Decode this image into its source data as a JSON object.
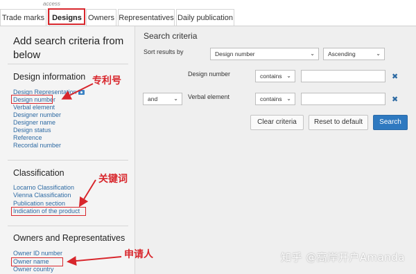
{
  "top_note": "access",
  "tabs": [
    {
      "label": "Trade marks"
    },
    {
      "label": "Designs"
    },
    {
      "label": "Owners"
    },
    {
      "label": "Representatives"
    },
    {
      "label": "Daily publication"
    }
  ],
  "left": {
    "title": "Add search criteria from below",
    "sections": [
      {
        "heading": "Design information",
        "items": [
          "Design Representation",
          "Design number",
          "Verbal element",
          "Designer number",
          "Designer name",
          "Design status",
          "Reference",
          "Recordal number"
        ]
      },
      {
        "heading": "Classification",
        "items": [
          "Locarno Classification",
          "Vienna Classification",
          "Publication section",
          "Indication of the product"
        ]
      },
      {
        "heading": "Owners and Representatives",
        "items": [
          "Owner ID number",
          "Owner name",
          "Owner country"
        ]
      }
    ]
  },
  "right": {
    "title": "Search criteria",
    "sort_label": "Sort results by",
    "sort_field": "Design number",
    "sort_order": "Ascending",
    "rows": [
      {
        "field": "Design number",
        "operator": "contains",
        "value": ""
      },
      {
        "logic": "and",
        "field": "Verbal element",
        "operator": "contains",
        "value": ""
      }
    ],
    "buttons": {
      "clear": "Clear criteria",
      "reset": "Reset to default",
      "search": "Search"
    }
  },
  "annotations": {
    "patent_number": "专利号",
    "keywords": "关键词",
    "applicant": "申请人",
    "color": "#d8262c"
  },
  "watermark": "知乎 @高岸开户Amanda"
}
